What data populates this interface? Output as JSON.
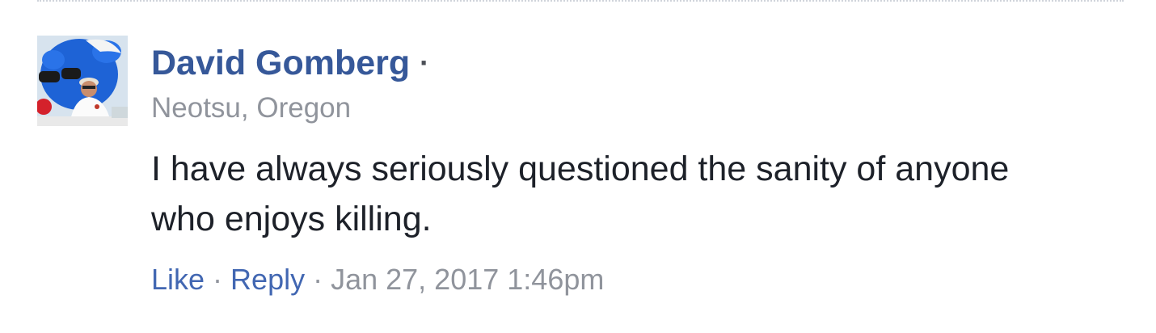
{
  "comment": {
    "author": "David Gomberg",
    "separator": "·",
    "location": "Neotsu, Oregon",
    "text": "I have always seriously questioned the sanity of anyone who enjoys killing.",
    "actions": {
      "like_label": "Like",
      "reply_label": "Reply",
      "separator": "·",
      "timestamp": "Jan 27, 2017 1:46pm"
    },
    "avatar_icon": "profile-photo"
  },
  "colors": {
    "author_link": "#365899",
    "action_link": "#4267b2",
    "meta_text": "#90949c",
    "body_text": "#1d2129"
  }
}
